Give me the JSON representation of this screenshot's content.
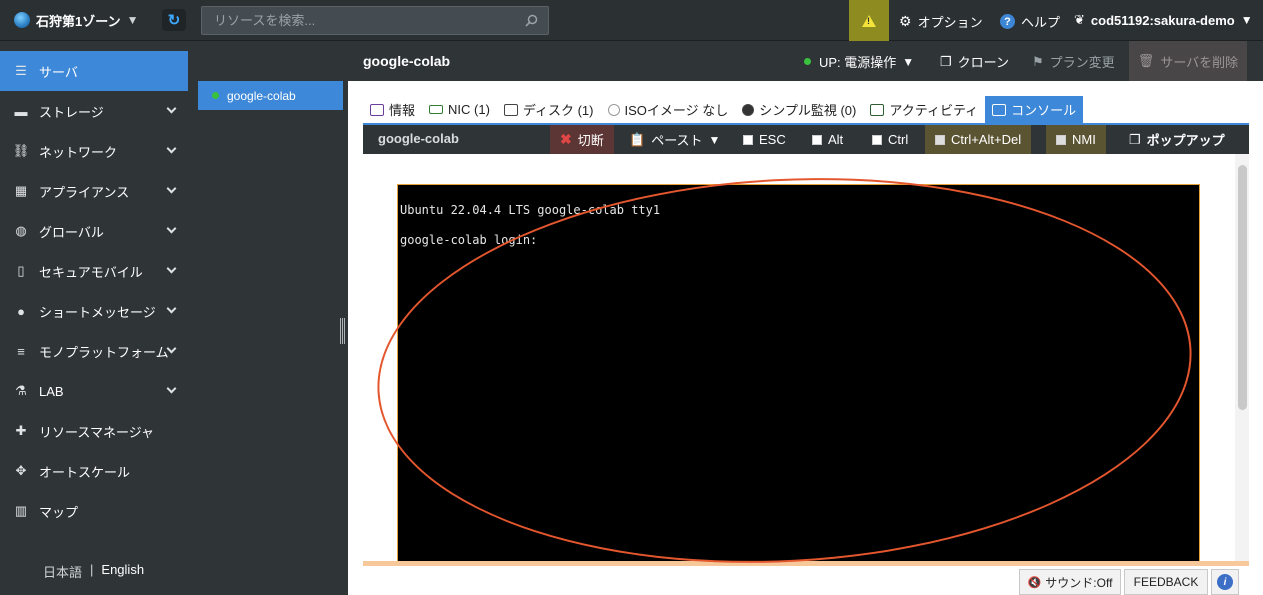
{
  "topbar": {
    "zone_label": "石狩第1ゾーン",
    "search_placeholder": "リソースを検索...",
    "options_label": "オプション",
    "help_label": "ヘルプ",
    "user_label": "cod51192:sakura-demo"
  },
  "sidebar": {
    "items": [
      {
        "label": "サーバ",
        "icon": "server-icon"
      },
      {
        "label": "ストレージ",
        "icon": "storage-icon"
      },
      {
        "label": "ネットワーク",
        "icon": "network-icon"
      },
      {
        "label": "アプライアンス",
        "icon": "appliance-icon"
      },
      {
        "label": "グローバル",
        "icon": "globe-icon"
      },
      {
        "label": "セキュアモバイル",
        "icon": "mobile-icon"
      },
      {
        "label": "ショートメッセージ",
        "icon": "chat-icon"
      },
      {
        "label": "モノプラットフォーム",
        "icon": "list-icon"
      },
      {
        "label": "LAB",
        "icon": "flask-icon"
      },
      {
        "label": "リソースマネージャ",
        "icon": "puzzle-icon"
      },
      {
        "label": "オートスケール",
        "icon": "arrows-icon"
      },
      {
        "label": "マップ",
        "icon": "map-icon"
      }
    ],
    "lang_ja": "日本語",
    "lang_sep": "|",
    "lang_en": "English"
  },
  "server_list": {
    "selected": "google-colab"
  },
  "header": {
    "server_name": "google-colab",
    "power_label": "UP: 電源操作",
    "clone_label": "クローン",
    "plan_label": "プラン変更",
    "delete_label": "サーバを削除"
  },
  "tabs": [
    {
      "label": "情報"
    },
    {
      "label": "NIC (1)"
    },
    {
      "label": "ディスク (1)"
    },
    {
      "label": "ISOイメージ なし"
    },
    {
      "label": "シンプル監視 (0)"
    },
    {
      "label": "アクティビティ"
    },
    {
      "label": "コンソール"
    }
  ],
  "console_toolbar": {
    "title": "google-colab",
    "disconnect": "切断",
    "paste": "ペースト",
    "esc": "ESC",
    "alt": "Alt",
    "ctrl": "Ctrl",
    "ctrl_alt_del": "Ctrl+Alt+Del",
    "nmi": "NMI",
    "popup": "ポップアップ"
  },
  "console": {
    "line1": "Ubuntu 22.04.4 LTS google-colab tty1",
    "line2": "google-colab login:"
  },
  "footer": {
    "sound": "サウンド:Off",
    "feedback": "FEEDBACK",
    "info": "i"
  },
  "colors": {
    "accent": "#3d88d8",
    "status_up": "#39c23d",
    "warning": "#8e8c20",
    "annotation_ring": "#e4572e"
  }
}
